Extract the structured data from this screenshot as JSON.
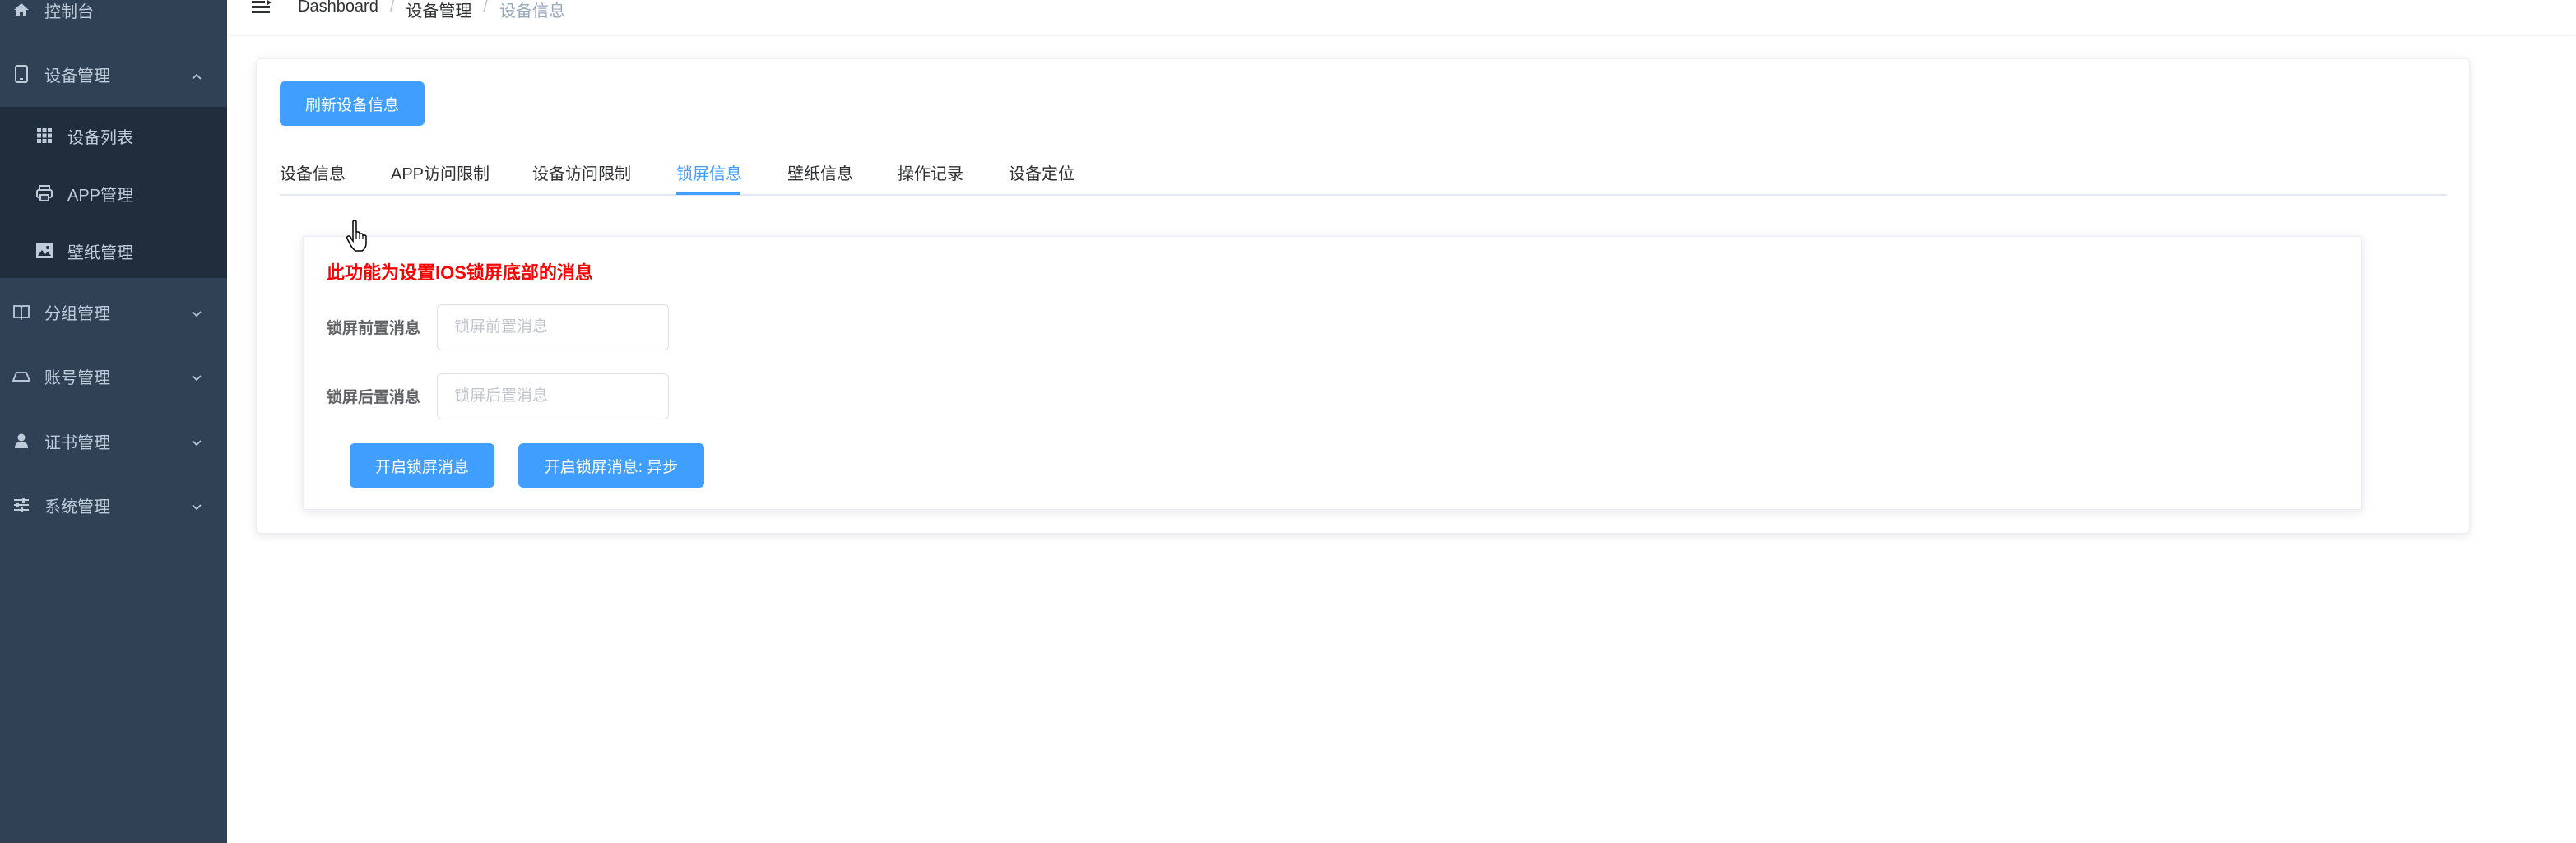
{
  "sidebar": {
    "items": [
      {
        "label": "控制台",
        "icon": "home-icon"
      },
      {
        "label": "设备管理",
        "icon": "tablet-icon",
        "expanded": true
      },
      {
        "label": "分组管理",
        "icon": "book-icon"
      },
      {
        "label": "账号管理",
        "icon": "tray-icon"
      },
      {
        "label": "证书管理",
        "icon": "user-icon"
      },
      {
        "label": "系统管理",
        "icon": "sliders-icon"
      }
    ],
    "sub_items": [
      {
        "label": "设备列表",
        "icon": "grid-icon"
      },
      {
        "label": "APP管理",
        "icon": "printer-icon"
      },
      {
        "label": "壁纸管理",
        "icon": "image-icon"
      }
    ]
  },
  "breadcrumb": {
    "items": [
      "Dashboard",
      "设备管理",
      "设备信息"
    ],
    "separator": "/"
  },
  "toolbar": {
    "refresh_label": "刷新设备信息"
  },
  "tabs": [
    {
      "label": "设备信息"
    },
    {
      "label": "APP访问限制"
    },
    {
      "label": "设备访问限制"
    },
    {
      "label": "锁屏信息",
      "active": true
    },
    {
      "label": "壁纸信息"
    },
    {
      "label": "操作记录"
    },
    {
      "label": "设备定位"
    }
  ],
  "lock_screen": {
    "notice": "此功能为设置IOS锁屏底部的消息",
    "front_label": "锁屏前置消息",
    "front_placeholder": "锁屏前置消息",
    "front_value": "",
    "back_label": "锁屏后置消息",
    "back_placeholder": "锁屏后置消息",
    "back_value": "",
    "enable_label": "开启锁屏消息",
    "enable_async_label": "开启锁屏消息: 异步"
  },
  "colors": {
    "sidebar_bg": "#304156",
    "submenu_bg": "#1f2d3d",
    "primary": "#409eff",
    "notice": "#ff0000"
  }
}
